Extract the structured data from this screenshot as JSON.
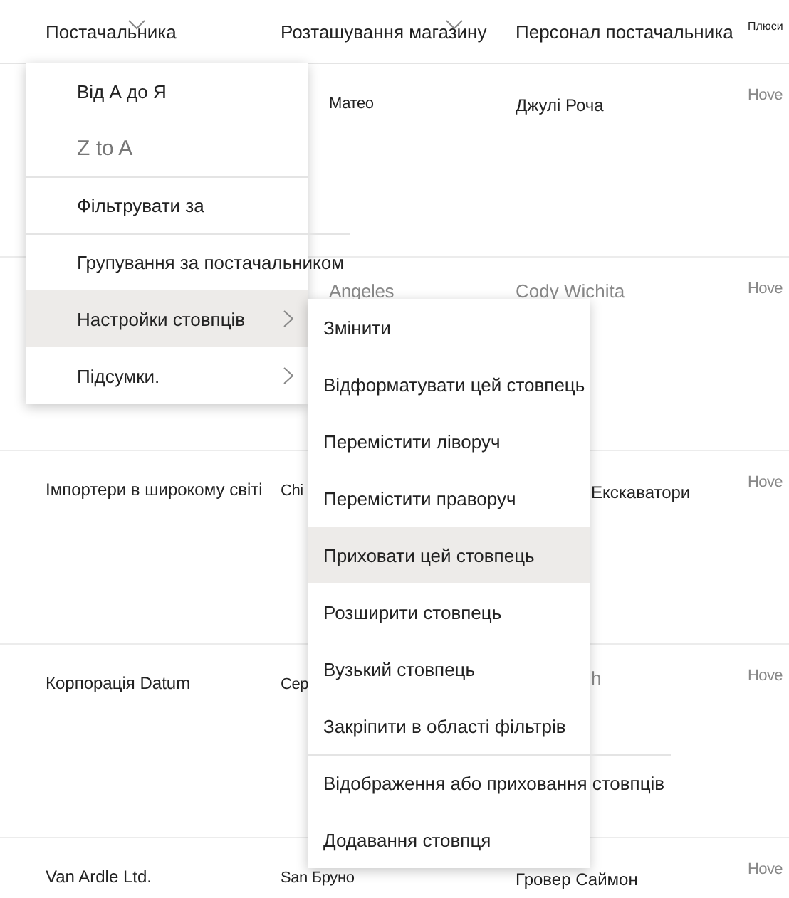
{
  "table": {
    "columns": [
      {
        "label": "Постачальника",
        "caret": true
      },
      {
        "label": "Розташування магазину",
        "caret": true
      },
      {
        "label": "Персонал постачальника",
        "caret": false
      },
      {
        "label": "Плюси",
        "caret": false
      }
    ],
    "rows": [
      {
        "cells": [
          null,
          {
            "text": "Матео",
            "dimmed": false
          },
          {
            "text": "Джулі Роча",
            "dimmed": false
          },
          {
            "text": "Hove",
            "dimmed": true
          }
        ]
      },
      {
        "cells": [
          null,
          {
            "text": "Angeles",
            "dimmed": true
          },
          {
            "text": "Cody Wichita",
            "dimmed": true
          },
          {
            "text": "Hove",
            "dimmed": true
          }
        ]
      },
      {
        "cells": [
          {
            "text": "Імпортери в широкому світі",
            "dimmed": false
          },
          {
            "text": "Chi",
            "dimmed": false
          },
          {
            "text": "Екскаватори",
            "dimmed": false
          },
          {
            "text": "Hove",
            "dimmed": true
          }
        ]
      },
      {
        "cells": [
          {
            "text": "Корпорація Datum",
            "dimmed": false
          },
          {
            "text": "Сер",
            "dimmed": false
          },
          {
            "text": "h",
            "dimmed": true
          },
          {
            "text": "Hove",
            "dimmed": true
          }
        ]
      },
      {
        "cells": [
          {
            "text": "Van Ardle Ltd.",
            "dimmed": false
          },
          {
            "text": "San Бруно",
            "dimmed": false
          },
          {
            "text": "Гровер Саймон",
            "dimmed": false
          },
          {
            "text": "Hove",
            "dimmed": true
          }
        ]
      }
    ]
  },
  "column_menu": {
    "items": [
      {
        "label": "Від А до Я",
        "disabled": false,
        "selected": false,
        "submenu": false,
        "divider_before": false
      },
      {
        "label": "Z to A",
        "disabled": true,
        "selected": false,
        "submenu": false,
        "divider_before": false
      },
      {
        "label": "Фільтрувати за",
        "disabled": false,
        "selected": false,
        "submenu": false,
        "divider_before": true
      },
      {
        "label": "Групування за постачальником",
        "disabled": false,
        "selected": false,
        "submenu": false,
        "divider_before": true
      },
      {
        "label": "Настройки стовпців",
        "disabled": false,
        "selected": true,
        "submenu": true,
        "divider_before": false
      },
      {
        "label": "Підсумки.",
        "disabled": false,
        "selected": false,
        "submenu": true,
        "divider_before": false
      }
    ]
  },
  "column_settings_submenu": {
    "items": [
      {
        "label": "Змінити",
        "selected": false,
        "divider_before": false
      },
      {
        "label": "Відформатувати цей стовпець",
        "selected": false,
        "divider_before": false
      },
      {
        "label": "Перемістити ліворуч",
        "selected": false,
        "divider_before": false
      },
      {
        "label": "Перемістити праворуч",
        "selected": false,
        "divider_before": false
      },
      {
        "label": "Приховати цей стовпець",
        "selected": true,
        "divider_before": false
      },
      {
        "label": "Розширити стовпець",
        "selected": false,
        "divider_before": false
      },
      {
        "label": "Вузький стовпець",
        "selected": false,
        "divider_before": false
      },
      {
        "label": "Закріпити в області фільтрів",
        "selected": false,
        "divider_before": false
      },
      {
        "label": "Відображення або приховання стовпців",
        "selected": false,
        "divider_before": true
      },
      {
        "label": "Додавання стовпця",
        "selected": false,
        "divider_before": false
      }
    ]
  }
}
